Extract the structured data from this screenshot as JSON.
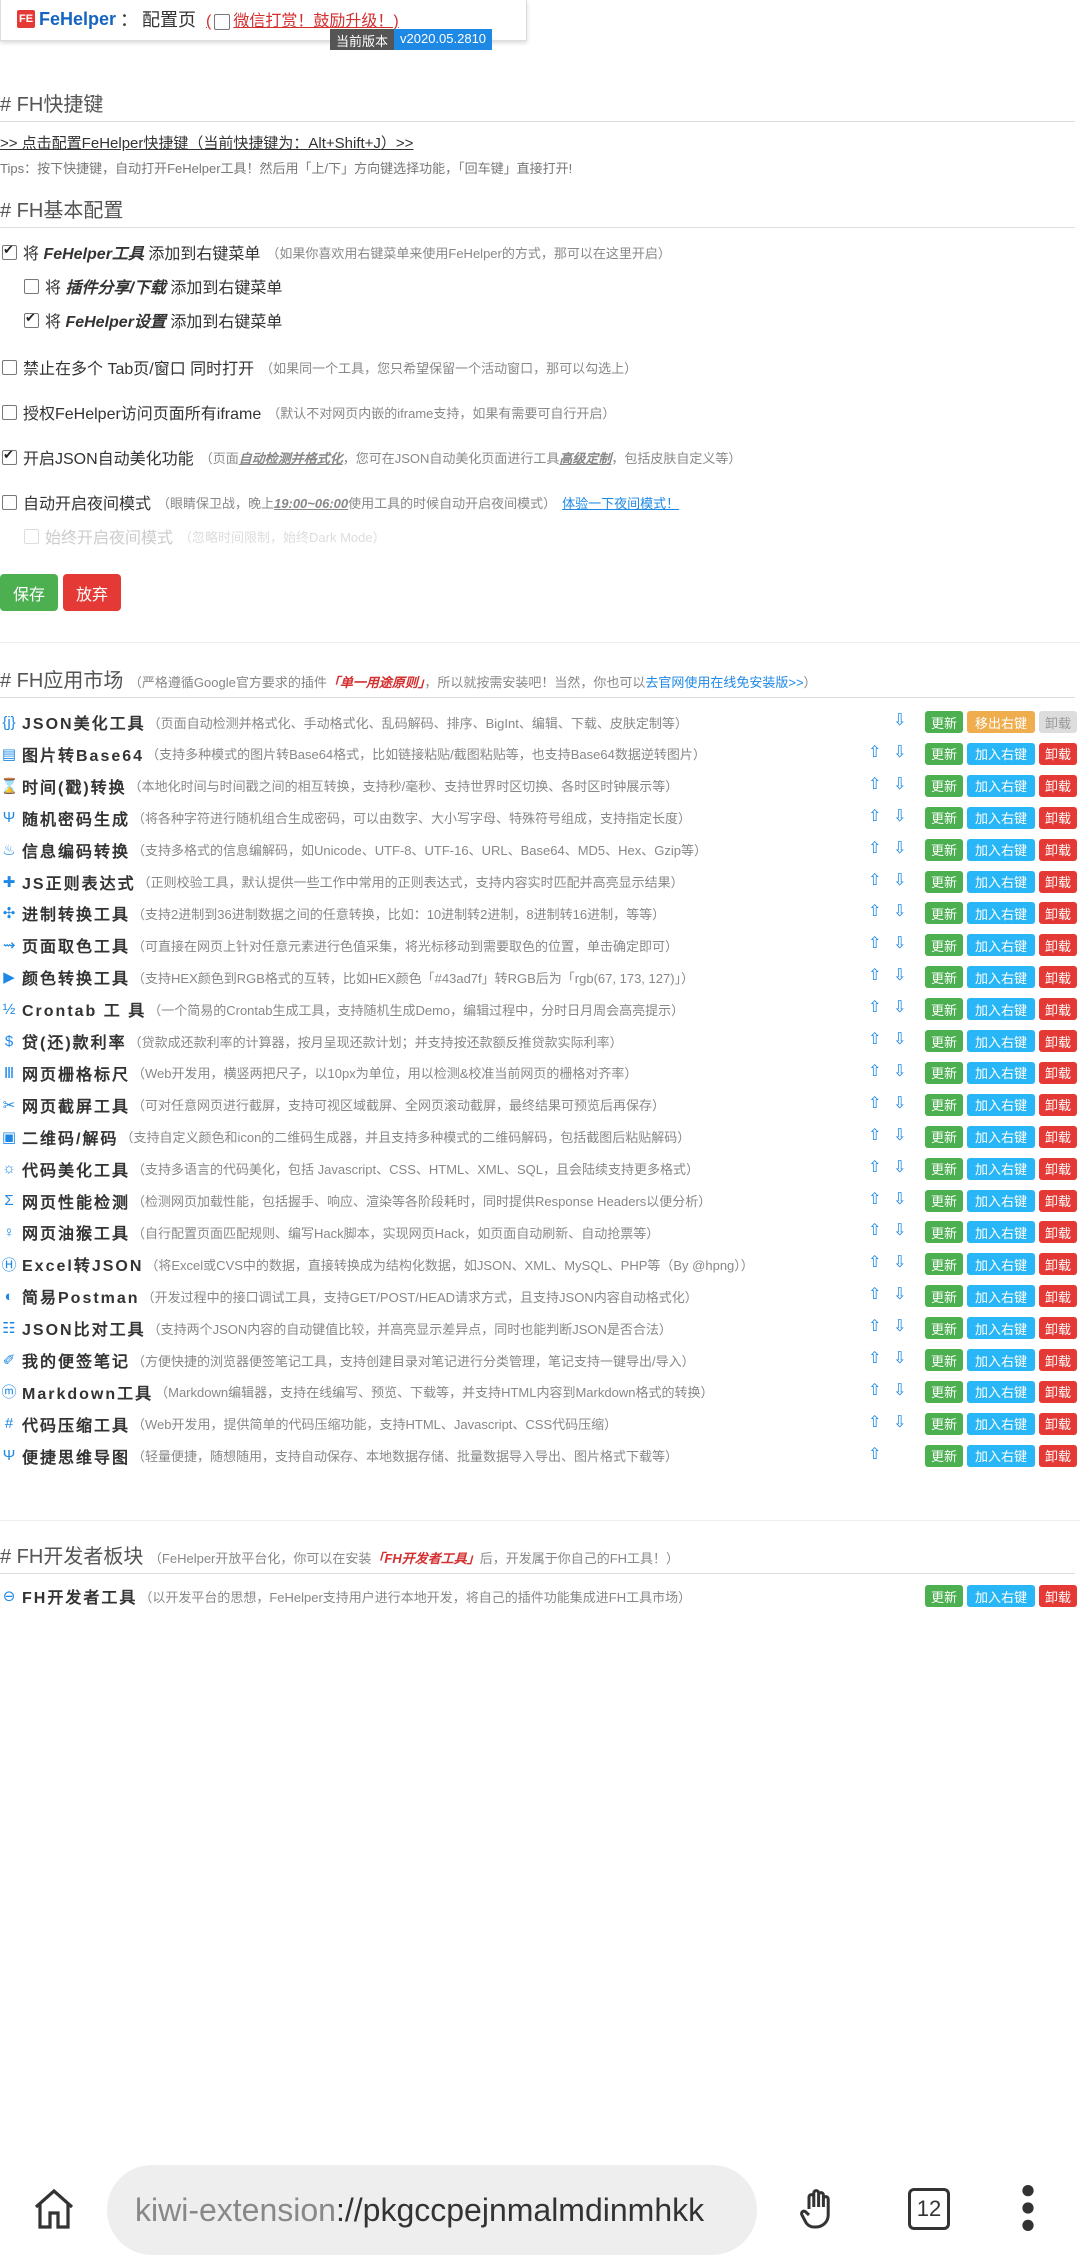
{
  "header": {
    "logo_text": "FE",
    "app_name": "FeHelper",
    "separator": "：",
    "page_title": "配置页",
    "reward_prefix": "(",
    "reward_text": "微信打赏！鼓励升级！)",
    "version_label": "当前版本",
    "version": "v2020.05.2810"
  },
  "shortcut_section": {
    "title": "# FH快捷键",
    "link": ">> 点击配置FeHelper快捷键（当前快捷键为：Alt+Shift+J）>>",
    "tips": "Tips：按下快捷键，自动打开FeHelper工具！然后用「上/下」方向键选择功能，「回车键」直接打开!"
  },
  "basic_section": {
    "title": "# FH基本配置",
    "options": [
      {
        "pre": "将 ",
        "bold": "FeHelper工具",
        "post": " 添加到右键菜单",
        "desc": "（如果你喜欢用右键菜单来使用FeHelper的方式，那可以在这里开启）",
        "checked": true
      },
      {
        "pre": "将 ",
        "bold": "插件分享/下载",
        "post": " 添加到右键菜单",
        "desc": "",
        "checked": false
      },
      {
        "pre": "将 ",
        "bold": "FeHelper设置",
        "post": " 添加到右键菜单",
        "desc": "",
        "checked": true
      },
      {
        "pre": "禁止在多个 Tab页/窗口 同时打开",
        "desc": "（如果同一个工具，您只希望保留一个活动窗口，那可以勾选上）",
        "checked": false
      },
      {
        "pre": "授权FeHelper访问页面所有iframe",
        "desc": "（默认不对网页内嵌的iframe支持，如果有需要可自行开启）",
        "checked": false
      },
      {
        "pre": "开启JSON自动美化功能",
        "desc_a": "（页面",
        "desc_u1": "自动检测并格式化",
        "desc_b": "，您可在JSON自动美化页面进行工具",
        "desc_u2": "高级定制",
        "desc_c": "，包括皮肤自定义等）",
        "checked": true
      },
      {
        "pre": "自动开启夜间模式",
        "desc_a": "（眼睛保卫战，晚上",
        "desc_u1": "19:00~06:00",
        "desc_b": "使用工具的时候自动开启夜间模式）",
        "link": "体验一下夜间模式！",
        "checked": false
      },
      {
        "pre": "始终开启夜间模式",
        "desc": "（忽略时间限制，始终Dark Mode）",
        "checked": false
      }
    ],
    "save_label": "保存",
    "cancel_label": "放弃"
  },
  "market_section": {
    "title": "# FH应用市场",
    "note_a": "（严格遵循Google官方要求的插件",
    "note_red": "「单一用途原则」",
    "note_b": "，所以就按需安装吧！当然，你也可以",
    "note_link": "去官网使用在线免安装版>>",
    "note_c": "）",
    "update_label": "更新",
    "add_label": "加入右键",
    "remove_label": "移出右键",
    "uninstall_label": "卸载",
    "tools": [
      {
        "icon": "{j}",
        "name": "JSON美化工具",
        "desc": "（页面自动检测并格式化、手动格式化、乱码解码、排序、BigInt、编辑、下载、皮肤定制等）"
      },
      {
        "icon": "▤",
        "name": "图片转Base64",
        "desc": "（支持多种模式的图片转Base64格式，比如链接粘贴/截图粘贴等，也支持Base64数据逆转图片）"
      },
      {
        "icon": "⌛",
        "name": "时间(戳)转换",
        "desc": "（本地化时间与时间戳之间的相互转换，支持秒/毫秒、支持世界时区切换、各时区时钟展示等）"
      },
      {
        "icon": "Ψ",
        "name": "随机密码生成",
        "desc": "（将各种字符进行随机组合生成密码，可以由数字、大小写字母、特殊符号组成，支持指定长度）"
      },
      {
        "icon": "♨",
        "name": "信息编码转换",
        "desc": "（支持多格式的信息编解码，如Unicode、UTF-8、UTF-16、URL、Base64、MD5、Hex、Gzip等）"
      },
      {
        "icon": "✚",
        "name": "JS正则表达式",
        "desc": "（正则校验工具，默认提供一些工作中常用的正则表达式，支持内容实时匹配并高亮显示结果）"
      },
      {
        "icon": "✣",
        "name": "进制转换工具",
        "desc": "（支持2进制到36进制数据之间的任意转换，比如：10进制转2进制，8进制转16进制，等等）"
      },
      {
        "icon": "⇝",
        "name": "页面取色工具",
        "desc": "（可直接在网页上针对任意元素进行色值采集，将光标移动到需要取色的位置，单击确定即可）"
      },
      {
        "icon": "▶",
        "name": "颜色转换工具",
        "desc": "（支持HEX颜色到RGB格式的互转，比如HEX颜色「#43ad7f」转RGB后为「rgb(67, 173, 127)」）"
      },
      {
        "icon": "½",
        "name": "Crontab 工 具",
        "desc": "（一个简易的Crontab生成工具，支持随机生成Demo，编辑过程中，分时日月周会高亮提示）"
      },
      {
        "icon": "$",
        "name": "贷(还)款利率",
        "desc": "（贷款成还款利率的计算器，按月呈现还款计划；并支持按还款额反推贷款实际利率）"
      },
      {
        "icon": "Ⅲ",
        "name": "网页栅格标尺",
        "desc": "（Web开发用，横竖两把尺子，以10px为单位，用以检测&校准当前网页的栅格对齐率）"
      },
      {
        "icon": "✂",
        "name": "网页截屏工具",
        "desc": "（可对任意网页进行截屏，支持可视区域截屏、全网页滚动截屏，最终结果可预览后再保存）"
      },
      {
        "icon": "▣",
        "name": "二维码/解码",
        "desc": "（支持自定义颜色和icon的二维码生成器，并且支持多种模式的二维码解码，包括截图后粘贴解码）"
      },
      {
        "icon": "☼",
        "name": "代码美化工具",
        "desc": "（支持多语言的代码美化，包括 Javascript、CSS、HTML、XML、SQL，且会陆续支持更多格式）"
      },
      {
        "icon": "Σ",
        "name": "网页性能检测",
        "desc": "（检测网页加载性能，包括握手、响应、渲染等各阶段耗时，同时提供Response Headers以便分析）"
      },
      {
        "icon": "♀",
        "name": "网页油猴工具",
        "desc": "（自行配置页面匹配规则、编写Hack脚本，实现网页Hack，如页面自动刷新、自动抢票等）"
      },
      {
        "icon": "Ⓗ",
        "name": "Excel转JSON",
        "desc": "（将Excel或CVS中的数据，直接转换成为结构化数据，如JSON、XML、MySQL、PHP等（By @hpng））"
      },
      {
        "icon": "◐",
        "name": "简易Postman",
        "desc": "（开发过程中的接口调试工具，支持GET/POST/HEAD请求方式，且支持JSON内容自动格式化）"
      },
      {
        "icon": "☷",
        "name": "JSON比对工具",
        "desc": "（支持两个JSON内容的自动键值比较，并高亮显示差异点，同时也能判断JSON是否合法）"
      },
      {
        "icon": "✐",
        "name": "我的便签笔记",
        "desc": "（方便快捷的浏览器便签笔记工具，支持创建目录对笔记进行分类管理，笔记支持一键导出/导入）"
      },
      {
        "icon": "ⓜ",
        "name": "Markdown工具",
        "desc": "（Markdown编辑器，支持在线编写、预览、下载等，并支持HTML内容到Markdown格式的转换）"
      },
      {
        "icon": "#",
        "name": "代码压缩工具",
        "desc": "（Web开发用，提供简单的代码压缩功能，支持HTML、Javascript、CSS代码压缩）"
      },
      {
        "icon": "Ψ",
        "name": "便捷思维导图",
        "desc": "（轻量便捷，随想随用，支持自动保存、本地数据存储、批量数据导入导出、图片格式下载等）"
      }
    ]
  },
  "dev_section": {
    "title": "# FH开发者板块",
    "note_a": "（FeHelper开放平台化，你可以在安装",
    "note_red": "「FH开发者工具」",
    "note_b": "后，开发属于你自己的FH工具！）",
    "tool": {
      "icon": "⊖",
      "name": "FH开发者工具",
      "desc": "（以开发平台的思想，FeHelper支持用户进行本地开发，将自己的插件功能集成进FH工具市场）"
    }
  },
  "browser": {
    "url_scheme": "kiwi-extension",
    "url_rest": "://pkgccpejnmalmdinmhkk",
    "tab_count": "12",
    "home_icon": "home-icon",
    "hand_icon": "hand-icon",
    "menu_icon": "more-vert-icon"
  }
}
